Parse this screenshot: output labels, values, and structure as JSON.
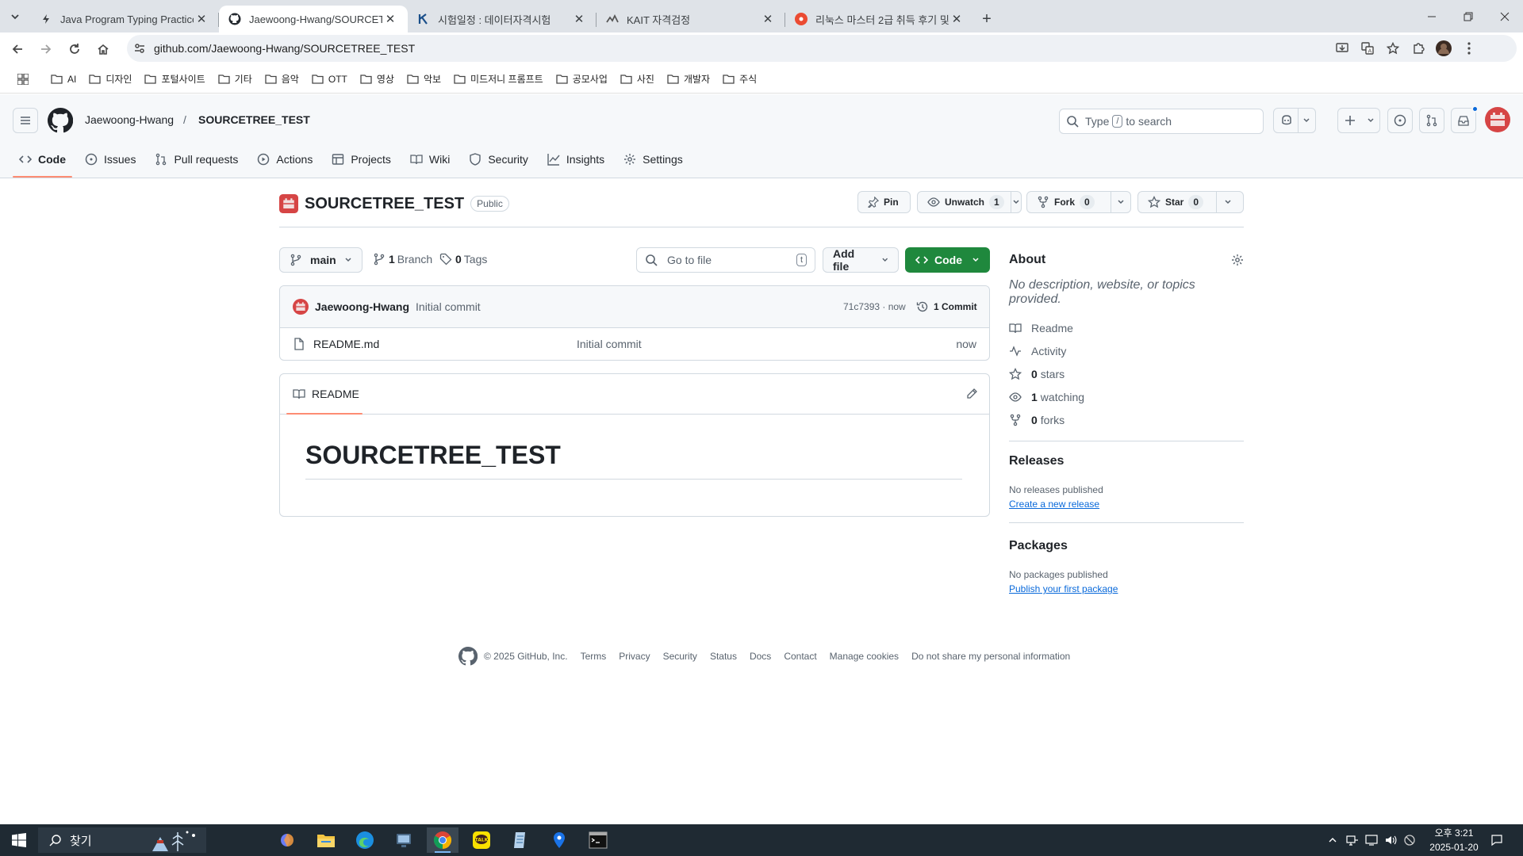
{
  "browser": {
    "tabs": [
      {
        "title": "Java Program Typing Practice",
        "icon": "bolt-icon"
      },
      {
        "title": "Jaewoong-Hwang/SOURCETREE_TEST",
        "icon": "github-icon"
      },
      {
        "title": "시험일정 : 데이터자격시험",
        "icon": "k-logo-icon"
      },
      {
        "title": "KAIT 자격검정",
        "icon": "kait-logo-icon"
      },
      {
        "title": "리눅스 마스터 2급 취득 후기 및",
        "icon": "tistory-icon"
      }
    ],
    "url": "github.com/Jaewoong-Hwang/SOURCETREE_TEST",
    "bookmarks": [
      "AI",
      "디자인",
      "포털사이트",
      "기타",
      "음악",
      "OTT",
      "영상",
      "악보",
      "미드저니 프롬프트",
      "공모사업",
      "사진",
      "개발자",
      "주식"
    ]
  },
  "github": {
    "owner": "Jaewoong-Hwang",
    "slash": "/",
    "repo": "SOURCETREE_TEST",
    "search_placeholder_pre": "Type",
    "search_key": "/",
    "search_placeholder_post": "to search",
    "nav": [
      "Code",
      "Issues",
      "Pull requests",
      "Actions",
      "Projects",
      "Wiki",
      "Security",
      "Insights",
      "Settings"
    ],
    "visibility": "Public",
    "pin": "Pin",
    "unwatch": "Unwatch",
    "unwatch_count": "1",
    "fork": "Fork",
    "fork_count": "0",
    "star": "Star",
    "star_count": "0",
    "branch": "main",
    "branches_count": "1",
    "branches_label": "Branch",
    "tags_count": "0",
    "tags_label": "Tags",
    "goto_file": "Go to file",
    "goto_key": "t",
    "add_file": "Add file",
    "code_btn": "Code",
    "commit": {
      "author": "Jaewoong-Hwang",
      "message": "Initial commit",
      "hash": "71c7393 · now",
      "count": "1 Commit"
    },
    "files": [
      {
        "name": "README.md",
        "message": "Initial commit",
        "time": "now"
      }
    ],
    "readme_tab": "README",
    "readme_h1": "SOURCETREE_TEST",
    "about": {
      "title": "About",
      "desc": "No description, website, or topics provided.",
      "items": [
        {
          "icon": "book-icon",
          "bold": "",
          "text": "Readme"
        },
        {
          "icon": "pulse-icon",
          "bold": "",
          "text": "Activity"
        },
        {
          "icon": "star-icon",
          "bold": "0",
          "text": "stars"
        },
        {
          "icon": "eye-icon",
          "bold": "1",
          "text": "watching"
        },
        {
          "icon": "fork-icon",
          "bold": "0",
          "text": "forks"
        }
      ]
    },
    "releases": {
      "title": "Releases",
      "empty": "No releases published",
      "link": "Create a new release"
    },
    "packages": {
      "title": "Packages",
      "empty": "No packages published",
      "link": "Publish your first package"
    },
    "footer": [
      "© 2025 GitHub, Inc.",
      "Terms",
      "Privacy",
      "Security",
      "Status",
      "Docs",
      "Contact",
      "Manage cookies",
      "Do not share my personal information"
    ]
  },
  "taskbar": {
    "search": "찾기",
    "time": "오후 3:21",
    "date": "2025-01-20"
  },
  "colors": {
    "accent_green": "#1f883d",
    "nav_underline": "#fd8c73",
    "link": "#0969da"
  }
}
